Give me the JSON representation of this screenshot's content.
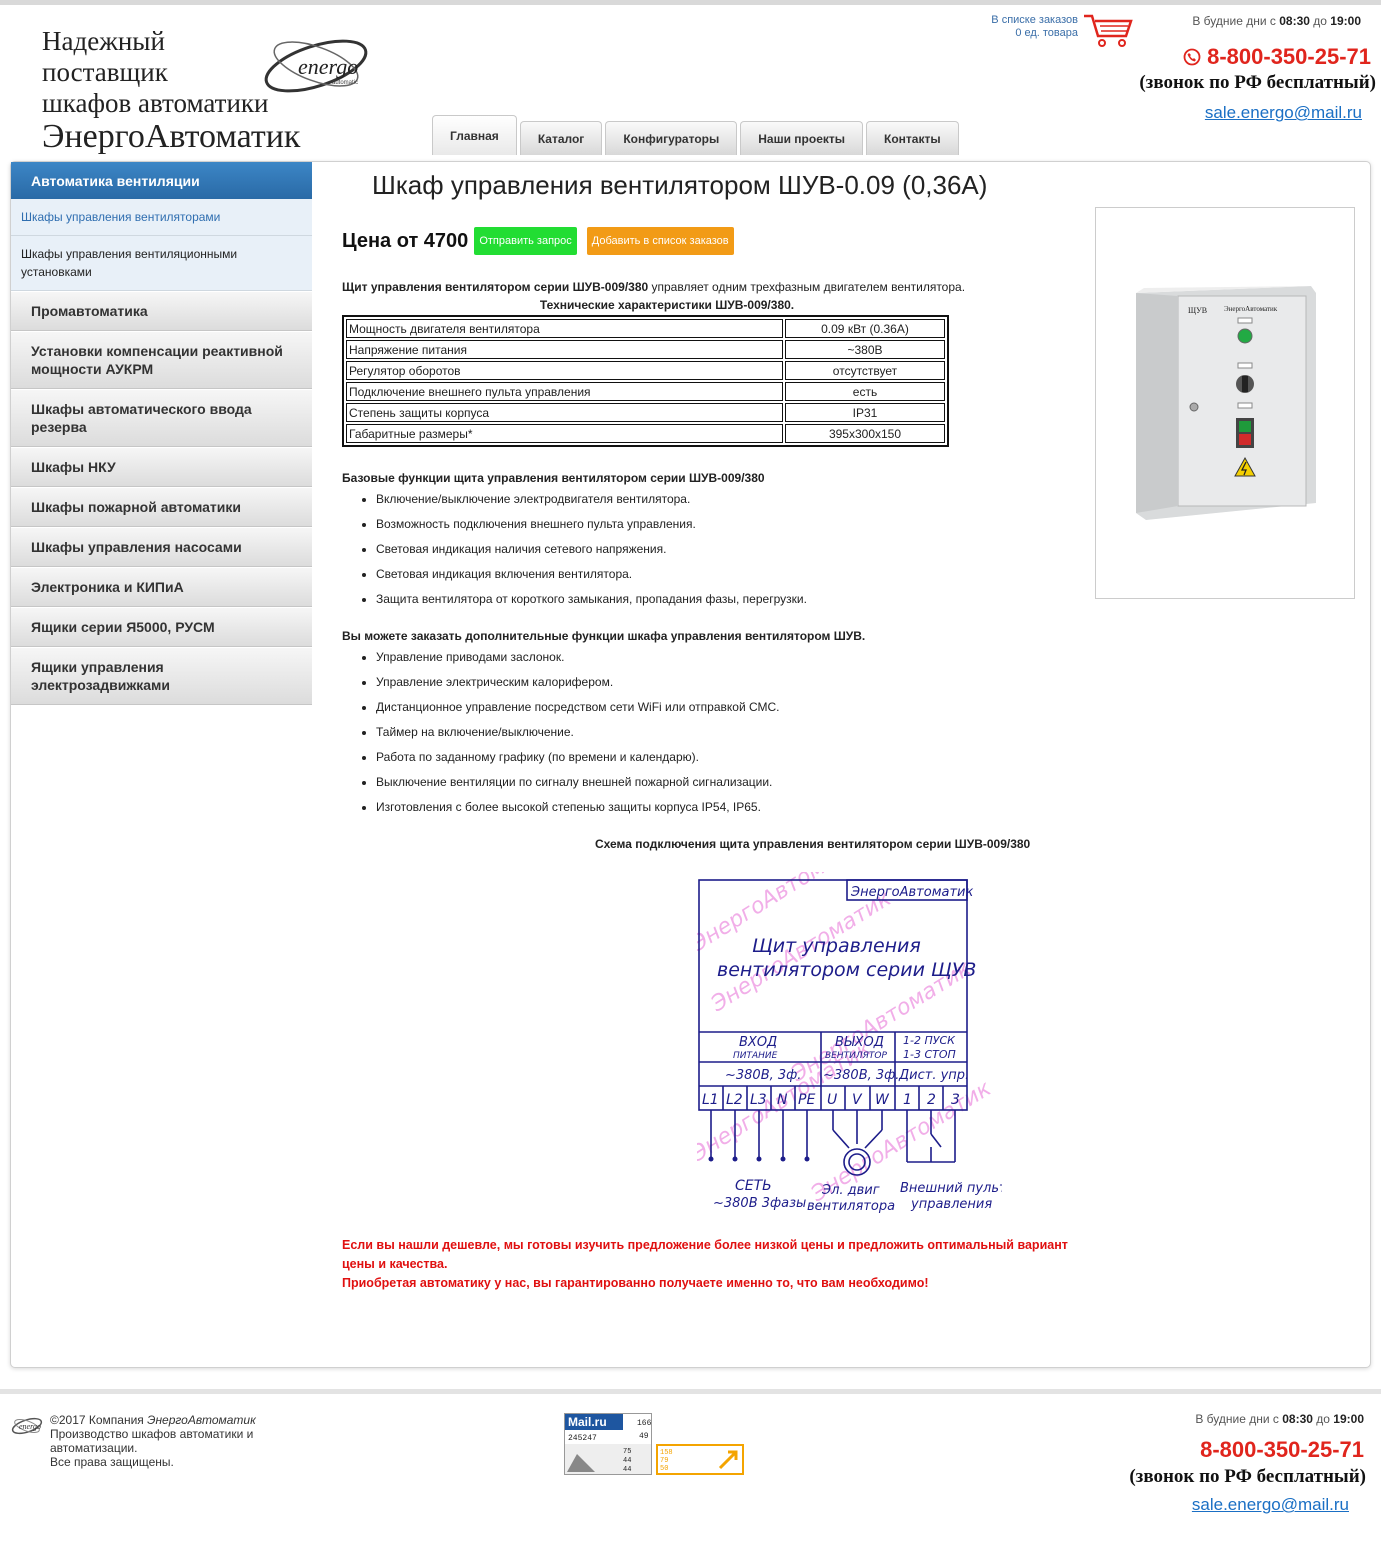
{
  "header": {
    "slogan_line1": "Надежный",
    "slogan_line2": "поставщик",
    "slogan_line3": "шкафов автоматики",
    "slogan_line4": "ЭнергоАвтоматик",
    "logo_text": "energo",
    "logo_sub": "automatic",
    "cart_label": "В списке заказов",
    "cart_count": "0 ед. товара",
    "hours_prefix": "В будние дни с",
    "hours_from": "08:30",
    "hours_mid": "до",
    "hours_to": "19:00",
    "phone": "8-800-350-25-71",
    "free_call": "(звонок по РФ бесплатный)",
    "email": "sale.energo@mail.ru"
  },
  "nav": {
    "tabs": [
      {
        "label": "Главная",
        "active": true
      },
      {
        "label": "Каталог",
        "active": false
      },
      {
        "label": "Конфигураторы",
        "active": false
      },
      {
        "label": "Наши проекты",
        "active": false
      },
      {
        "label": "Контакты",
        "active": false
      }
    ]
  },
  "sidebar": {
    "head": "Автоматика вентиляции",
    "subitems": [
      "Шкафы управления вентиляторами",
      "Шкафы управления вентиляционными установками"
    ],
    "items": [
      "Промавтоматика",
      "Установки компенсации реактивной мощности АУКРМ",
      "Шкафы автоматического ввода резерва",
      "Шкафы НКУ",
      "Шкафы пожарной автоматики",
      "Шкафы управления насосами",
      "Электроника и КИПиА",
      "Ящики серии Я5000, РУСМ",
      "Ящики управления электрозадвижками"
    ]
  },
  "product": {
    "title": "Шкаф управления вентилятором ШУВ-0.09 (0,36А)",
    "price": "Цена от 4700",
    "send_request": "Отправить запрос",
    "add_to_list": "Добавить в список заказов",
    "intro_bold": "Щит управления вентилятором серии  ШУВ-009/380",
    "intro_rest": " управляет одним трехфазным двигателем вентилятора.",
    "specs_title": "Технические характеристики ШУВ-009/380.",
    "specs": [
      {
        "name": "Мощность двигателя вентилятора",
        "value": "0.09 кВт (0.36А)"
      },
      {
        "name": "Напряжение питания",
        "value": "~380В"
      },
      {
        "name": "Регулятор оборотов",
        "value": "отсутствует"
      },
      {
        "name": "Подключение внешнего пульта управления",
        "value": "есть"
      },
      {
        "name": "Степень защиты корпуса",
        "value": "IP31"
      },
      {
        "name": "Габаритные размеры*",
        "value": "395х300х150"
      }
    ],
    "base_title": "Базовые функции щита управления вентилятором серии ШУВ-009/380",
    "base_functions": [
      "Включение/выключение электродвигателя вентилятора.",
      "Возможность подключения внешнего пульта управления.",
      "Световая индикация наличия сетевого напряжения.",
      "Световая индикация включения вентилятора.",
      "Защита вентилятора от короткого замыкания, пропадания фазы, перегрузки."
    ],
    "extra_title": "Вы можете заказать дополнительные функции шкафа управления вентилятором ШУВ.",
    "extra_functions": [
      "Управление приводами заслонок.",
      "Управление электрическим калорифером.",
      "Дистанционное управление посредством сети WiFi или отправкой СМС.",
      "Таймер на включение/выключение.",
      "Работа по заданному графику (по времени и календарю).",
      "Выключение вентиляции по сигналу внешней пожарной сигнализации.",
      "Изготовления с более высокой степенью защиты корпуса IP54, IP65."
    ],
    "scheme_title": "Схема подключения щита управления вентилятором серии ШУВ-009/380",
    "notice_line1": "Если вы нашли дешевле, мы готовы изучить предложение более низкой цены и предложить оптимальный вариант цены и качества.",
    "notice_line2": "Приобретая автоматику у нас, вы гарантированно получаете именно то, что вам необходимо!"
  },
  "scheme": {
    "brand": "ЭнергоАвтоматик",
    "title1": "Щит управления",
    "title2": "вентилятором серии ЩУВ",
    "in_label": "ВХОД",
    "in_sub": "ПИТАНИЕ",
    "out_label": "ВЫХОД",
    "out_sub": "ВЕНТИЛЯТОР",
    "ctrl1": "1-2 ПУСК",
    "ctrl2": "1-3 СТОП",
    "v_in": "~380В, 3ф.",
    "v_out": "~380В, 3ф.",
    "v_ctrl": "Дист. упр.",
    "terminals": [
      "L1",
      "L2",
      "L3",
      "N",
      "PE",
      "U",
      "V",
      "W",
      "1",
      "2",
      "3"
    ],
    "net1": "СЕТЬ",
    "net2": "~380В 3фазы",
    "motor1": "Эл. двиг",
    "motor2": "вентилятора",
    "remote1": "Внешний пульт",
    "remote2": "управления",
    "watermark": "ЭнергоАвтоматик"
  },
  "product_image": {
    "label_left": "ЩУВ",
    "label_right": "ЭнергоАвтоматик"
  },
  "footer": {
    "copyright_prefix": "©2017 Компания ",
    "company": "ЭнергоАвтоматик",
    "line2": "Производство шкафов автоматики и автоматизации.",
    "line3": "Все права защищены.",
    "counter1_brand": "Mail.ru",
    "counter1_a": "166",
    "counter1_b": "49",
    "counter1_c": "245247",
    "counter1_d": "75",
    "counter1_e": "44",
    "counter1_f": "44",
    "counter2_a": "158",
    "counter2_b": "79",
    "counter2_c": "50",
    "hours_prefix": "В будние дни с",
    "hours_from": "08:30",
    "hours_mid": "до",
    "hours_to": "19:00",
    "phone": "8-800-350-25-71",
    "free_call": "(звонок по РФ бесплатный)",
    "email": "sale.energo@mail.ru"
  },
  "colors": {
    "accent_blue": "#2a6aa6",
    "phone_red": "#e0251d",
    "button_green": "#22dd33",
    "button_orange": "#f29b16",
    "scheme_ink": "#1d1d8a",
    "watermark_pink": "#f0a6e6"
  }
}
